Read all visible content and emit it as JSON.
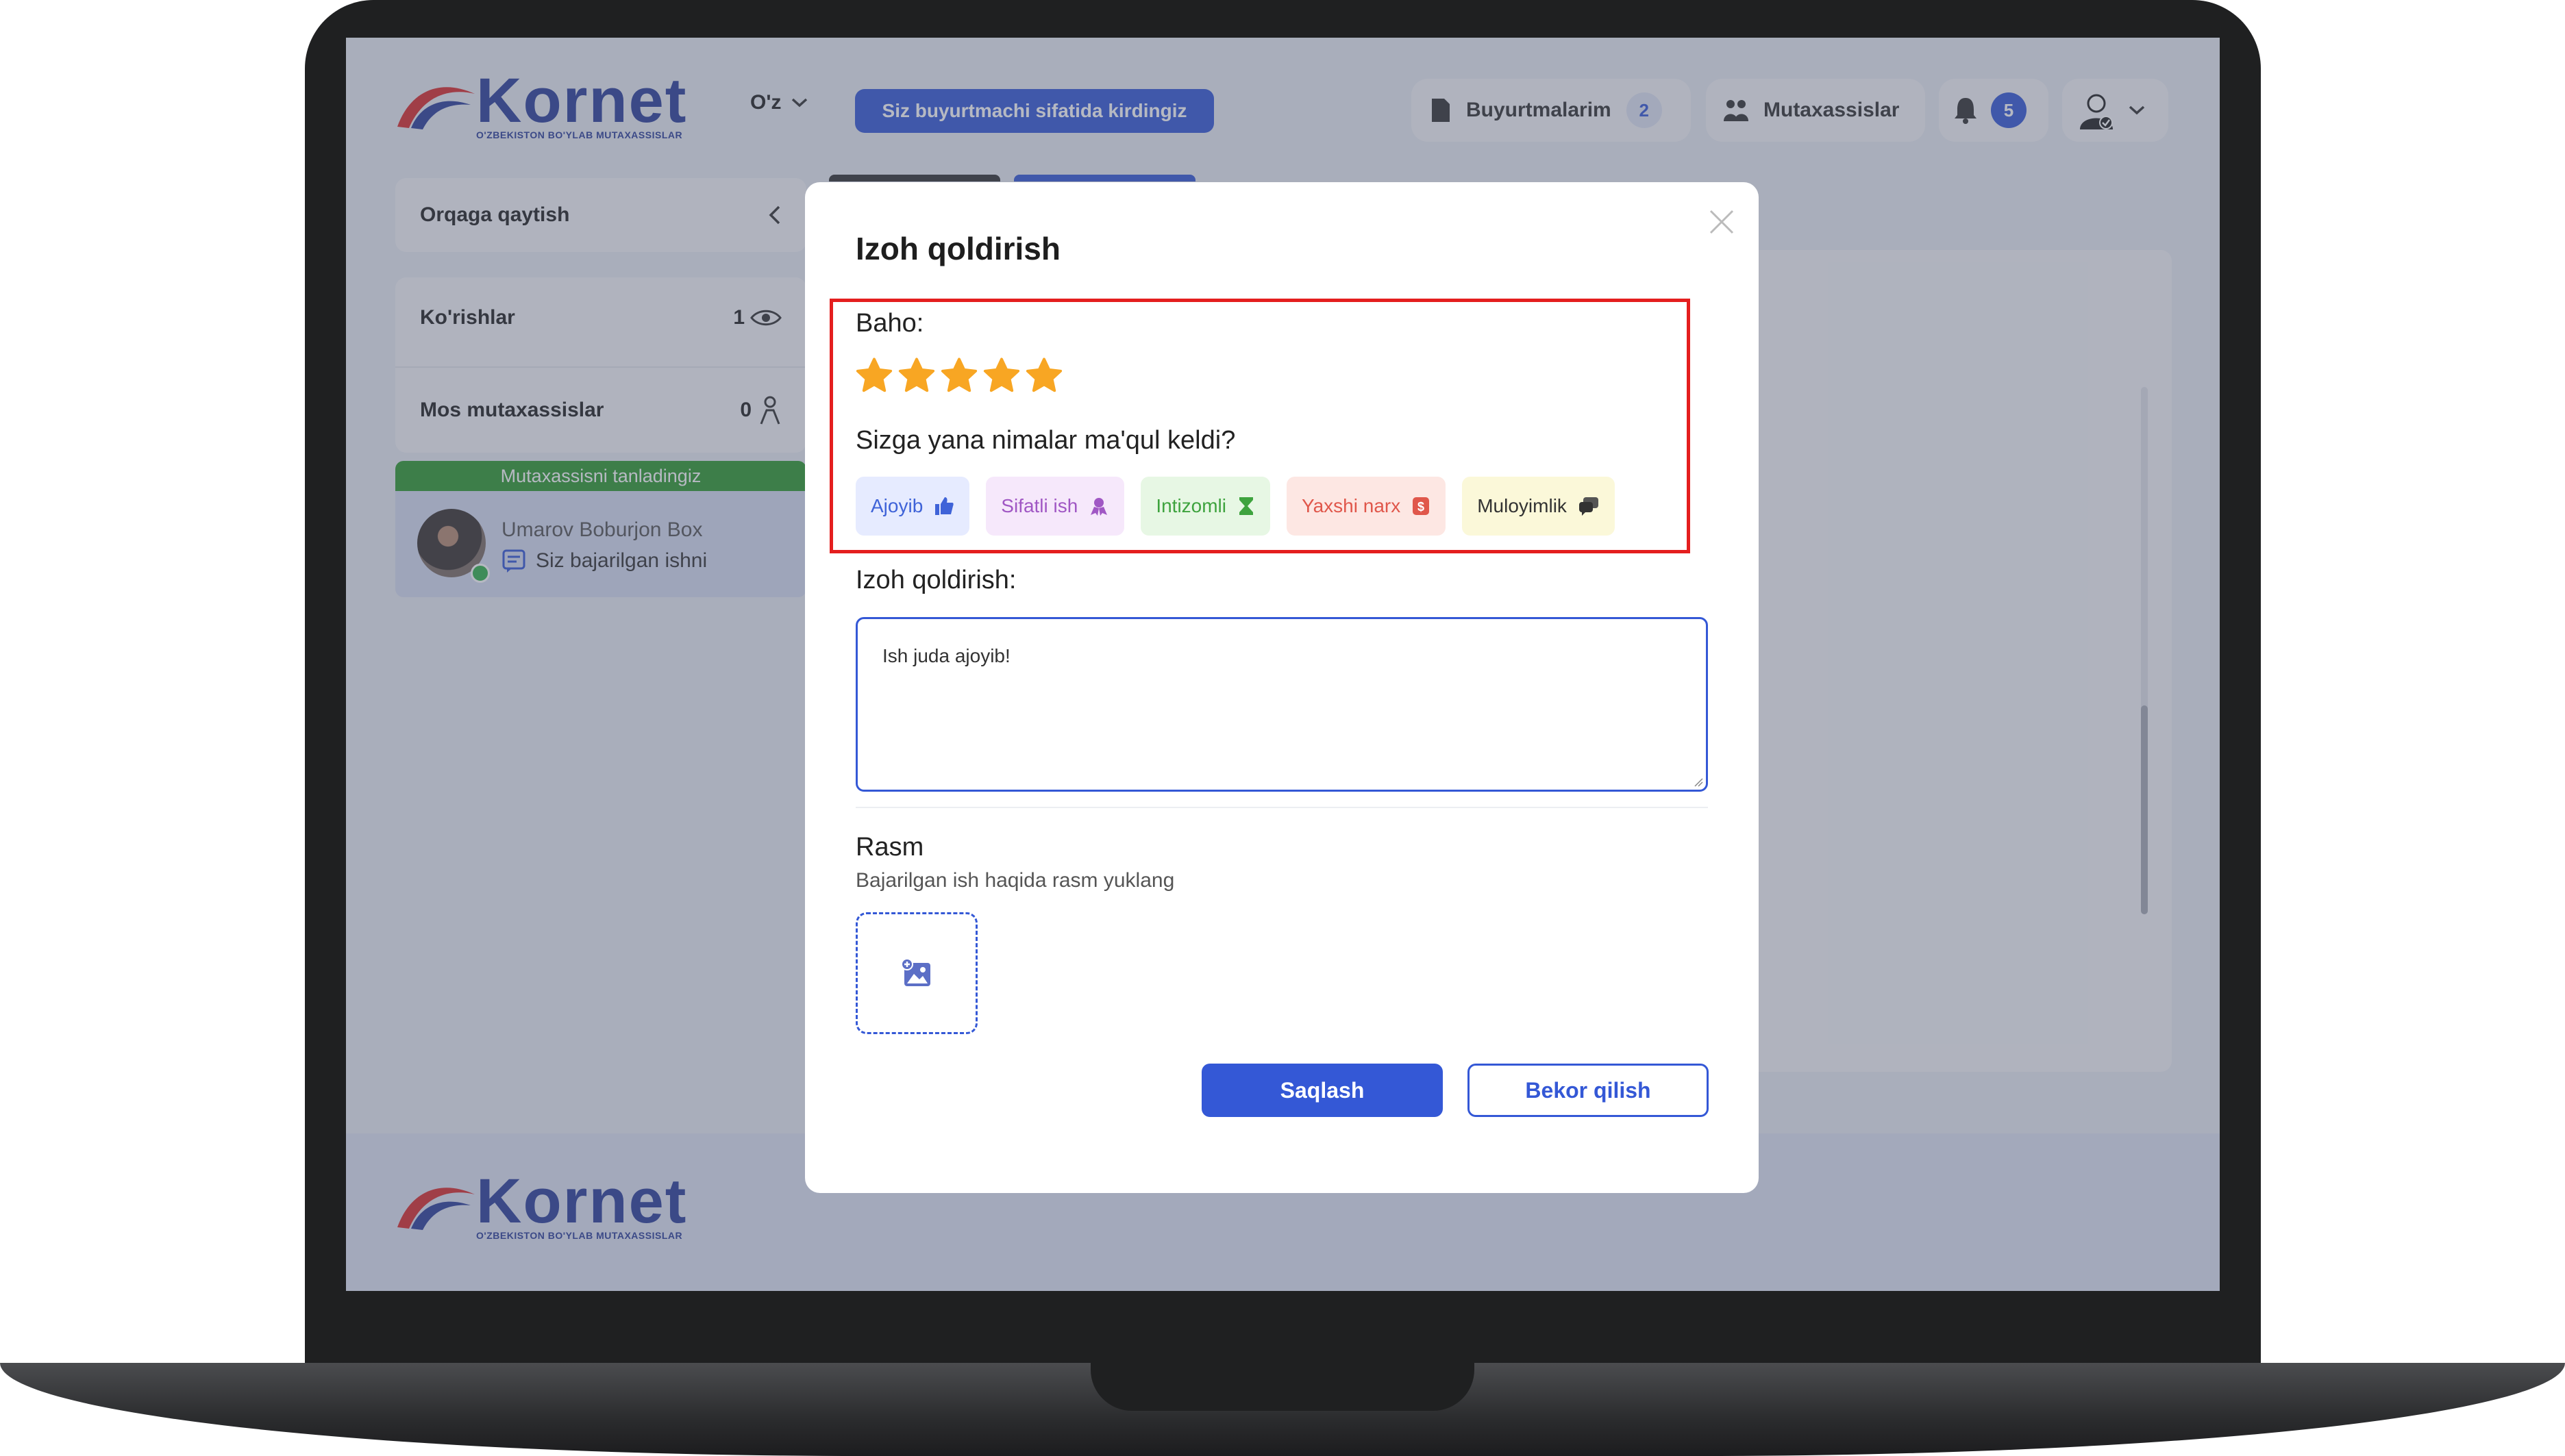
{
  "header": {
    "logo_text": "Kornet",
    "logo_sub": "O'ZBEKISTON BO'YLAB MUTAXASSISLAR",
    "language": "O'z",
    "role_badge": "Siz buyurtmachi sifatida kirdingiz",
    "orders_label": "Buyurtmalarim",
    "orders_count": "2",
    "specialists_label": "Mutaxassislar",
    "notifications_count": "5"
  },
  "sidebar": {
    "back_label": "Orqaga qaytish",
    "views_label": "Ko'rishlar",
    "views_count": "1",
    "matches_label": "Mos mutaxassislar",
    "matches_count": "0",
    "selected_banner": "Mutaxassisni tanladingiz",
    "specialist_name": "Umarov Boburjon Box",
    "specialist_message": "Siz bajarilgan ishni"
  },
  "footer": {
    "logo_text": "Kornet",
    "logo_sub": "O'ZBEKISTON BO'YLAB MUTAXASSISLAR"
  },
  "modal": {
    "title": "Izoh qoldirish",
    "rating_label": "Baho:",
    "rating_value": 5,
    "rating_max": 5,
    "liked_question": "Sizga yana nimalar ma'qul keldi?",
    "chips": [
      {
        "label": "Ajoyib",
        "icon": "thumbs-up-icon",
        "color": "#3f63d8",
        "bg": "#e6ebff"
      },
      {
        "label": "Sifatli ish",
        "icon": "quality-icon",
        "color": "#a057c4",
        "bg": "#f6e8fb"
      },
      {
        "label": "Intizomli",
        "icon": "hourglass-icon",
        "color": "#3ea33e",
        "bg": "#e7f7e4"
      },
      {
        "label": "Yaxshi narx",
        "icon": "price-icon",
        "color": "#e0574b",
        "bg": "#fde7e3"
      },
      {
        "label": "Muloyimlik",
        "icon": "chat-icon",
        "color": "#333333",
        "bg": "#fbf8d9"
      }
    ],
    "comment_label": "Izoh qoldirish:",
    "comment_value": "Ish juda ajoyib!",
    "image_label": "Rasm",
    "image_hint": "Bajarilgan ish haqida rasm yuklang",
    "save_label": "Saqlash",
    "cancel_label": "Bekor qilish"
  },
  "colors": {
    "primary": "#3458d6",
    "star": "#f8a623",
    "highlight": "#e41e1e",
    "selected_green": "#2f9a2f"
  }
}
